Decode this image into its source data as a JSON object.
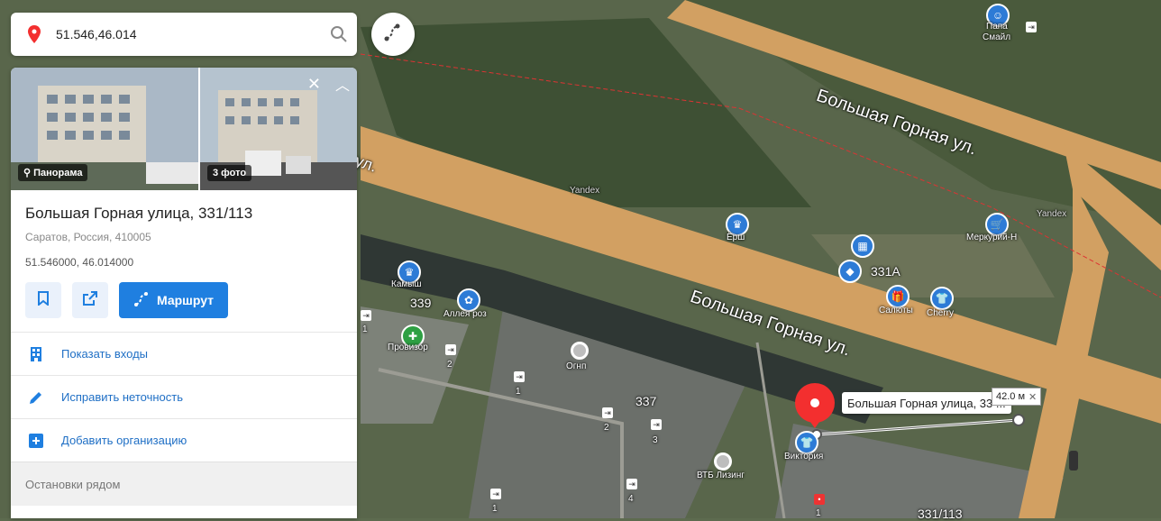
{
  "search": {
    "value": "51.546,46.014"
  },
  "photos": {
    "panorama_label": "Панорама",
    "photos_label": "3 фото"
  },
  "place": {
    "title": "Большая Горная улица, 331/113",
    "subtitle": "Саратов, Россия, 410005",
    "coords": "51.546000, 46.014000"
  },
  "actions": {
    "route_label": "Маршрут"
  },
  "menu": {
    "entrances": "Показать входы",
    "fix": "Исправить неточность",
    "add_org": "Добавить организацию"
  },
  "stops": {
    "label": "Остановки рядом"
  },
  "map": {
    "street_top": "Большая Горная ул.",
    "street_mid": "Большая Горная ул.",
    "street_left_fragment": "ул.",
    "poi": {
      "papa": [
        "Папа",
        "Смайл"
      ],
      "yorsh": "Ёрш",
      "merkuriy": "Меркурий-Н",
      "kamysh": "Камыш",
      "alleya": "Аллея роз",
      "provizor": "Провизор",
      "ognp": "Огнп",
      "salyuty": "Салюты",
      "cherry": "Cherry",
      "vtb": "ВТБ Лизинг",
      "viktoriya": "Виктория"
    },
    "houses": {
      "h331a": "331А",
      "h339": "339",
      "h337": "337",
      "h331_113": "331/113"
    },
    "entrances": [
      "1",
      "2",
      "1",
      "2",
      "3",
      "4",
      "1",
      "1"
    ],
    "watermark1": "Yandex",
    "watermark2": "Yandex",
    "tooltip": "Большая Горная улица, 33 ...",
    "distance": "42.0 м"
  },
  "colors": {
    "accent": "#1f7fe0",
    "pin": "#f32f2f",
    "road": "#d8a867"
  }
}
